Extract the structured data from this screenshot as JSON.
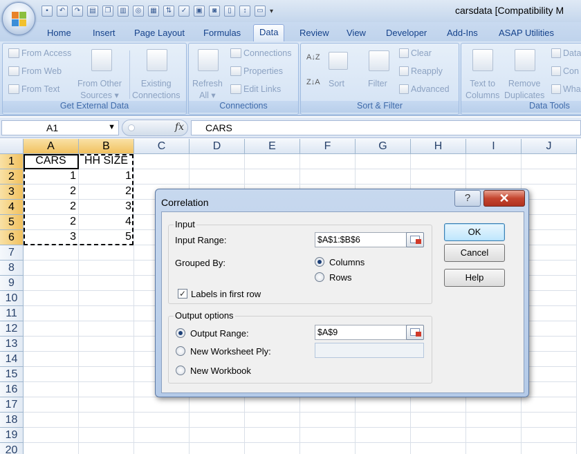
{
  "window": {
    "title": "carsdata  [Compatibility M"
  },
  "tabs": [
    {
      "label": "Home"
    },
    {
      "label": "Insert"
    },
    {
      "label": "Page Layout"
    },
    {
      "label": "Formulas"
    },
    {
      "label": "Data"
    },
    {
      "label": "Review"
    },
    {
      "label": "View"
    },
    {
      "label": "Developer"
    },
    {
      "label": "Add-Ins"
    },
    {
      "label": "ASAP Utilities"
    }
  ],
  "ribbon": {
    "get_external": {
      "title": "Get External Data",
      "from_access": "From Access",
      "from_web": "From Web",
      "from_text": "From Text",
      "from_other_1": "From Other",
      "from_other_2": "Sources ▾",
      "existing_1": "Existing",
      "existing_2": "Connections"
    },
    "connections": {
      "title": "Connections",
      "refresh_1": "Refresh",
      "refresh_2": "All ▾",
      "connections": "Connections",
      "properties": "Properties",
      "edit_links": "Edit Links"
    },
    "sort_filter": {
      "title": "Sort & Filter",
      "sort": "Sort",
      "filter": "Filter",
      "clear": "Clear",
      "reapply": "Reapply",
      "advanced": "Advanced"
    },
    "data_tools": {
      "title": "Data Tools",
      "text_cols_1": "Text to",
      "text_cols_2": "Columns",
      "remove_dup_1": "Remove",
      "remove_dup_2": "Duplicates",
      "data_v": "Data",
      "cons": "Con",
      "what": "Wha"
    }
  },
  "formula_bar": {
    "name_box": "A1",
    "fx": "fx",
    "formula": "CARS"
  },
  "sheet": {
    "columns": [
      "A",
      "B",
      "C",
      "D",
      "E",
      "F",
      "G",
      "H",
      "I",
      "J"
    ],
    "rows": [
      "1",
      "2",
      "3",
      "4",
      "5",
      "6",
      "7",
      "8",
      "9",
      "10",
      "11",
      "12",
      "13",
      "14",
      "15",
      "16",
      "17",
      "18",
      "19",
      "20"
    ],
    "header_a": "CARS",
    "header_b": "HH SIZE",
    "data": [
      [
        "1",
        "1"
      ],
      [
        "2",
        "2"
      ],
      [
        "2",
        "3"
      ],
      [
        "2",
        "4"
      ],
      [
        "3",
        "5"
      ]
    ]
  },
  "dialog": {
    "title": "Correlation",
    "help_glyph": "?",
    "close_glyph": "✕",
    "input_legend": "Input",
    "input_range_label": "Input Range:",
    "input_range_value": "$A$1:$B$6",
    "grouped_by_label": "Grouped By:",
    "columns_label": "Columns",
    "rows_label": "Rows",
    "labels_first_row": "Labels in first row",
    "output_legend": "Output options",
    "output_range_label": "Output Range:",
    "output_range_value": "$A$9",
    "new_ply_label": "New Worksheet Ply:",
    "new_workbook_label": "New Workbook",
    "ok": "OK",
    "cancel": "Cancel",
    "help": "Help"
  }
}
